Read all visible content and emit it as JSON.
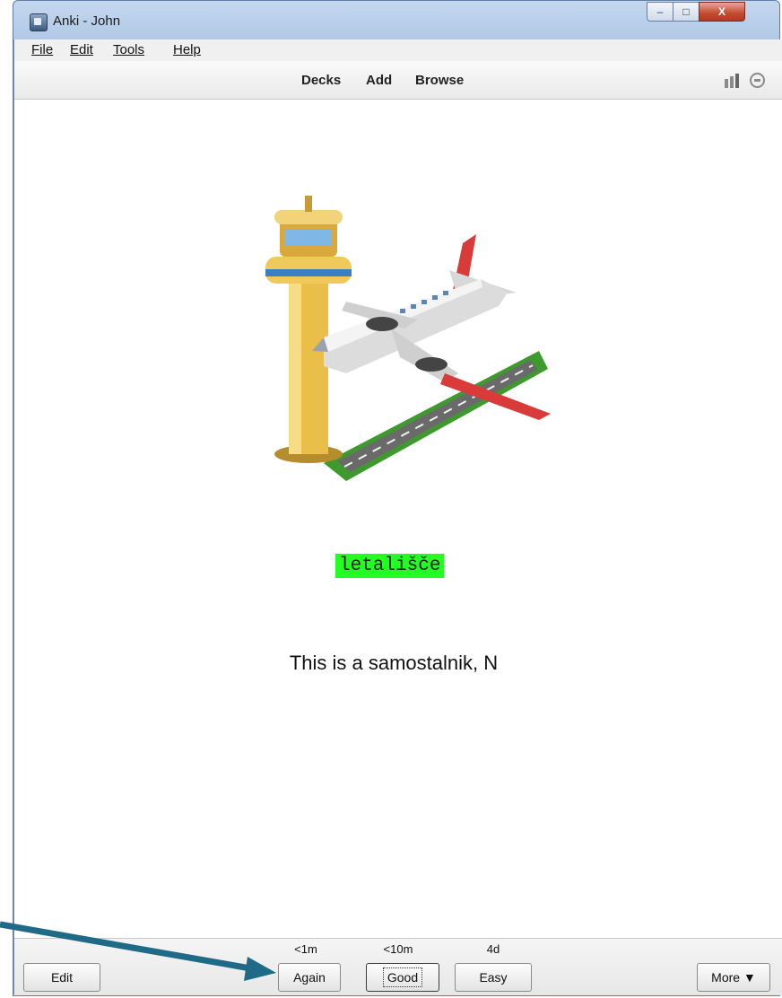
{
  "window": {
    "title": "Anki - John",
    "minimize": "–",
    "maximize": "□",
    "close": "X"
  },
  "menu": [
    "File",
    "Edit",
    "Tools",
    "Help"
  ],
  "toolbar": {
    "decks": "Decks",
    "add": "Add",
    "browse": "Browse",
    "stats_icon": "stats-icon",
    "sync_icon": "sync-icon"
  },
  "card": {
    "image": "airport-tower-and-airplane",
    "word": "letališče",
    "hint": "This is a samostalnik, N",
    "word_highlight": "#22ff22"
  },
  "bottom": {
    "edit": "Edit",
    "answers": [
      {
        "label": "Again",
        "interval": "<1m"
      },
      {
        "label": "Good",
        "interval": "<10m"
      },
      {
        "label": "Easy",
        "interval": "4d"
      }
    ],
    "more": "More ▼"
  },
  "annotation": {
    "color": "#1f6a86"
  }
}
